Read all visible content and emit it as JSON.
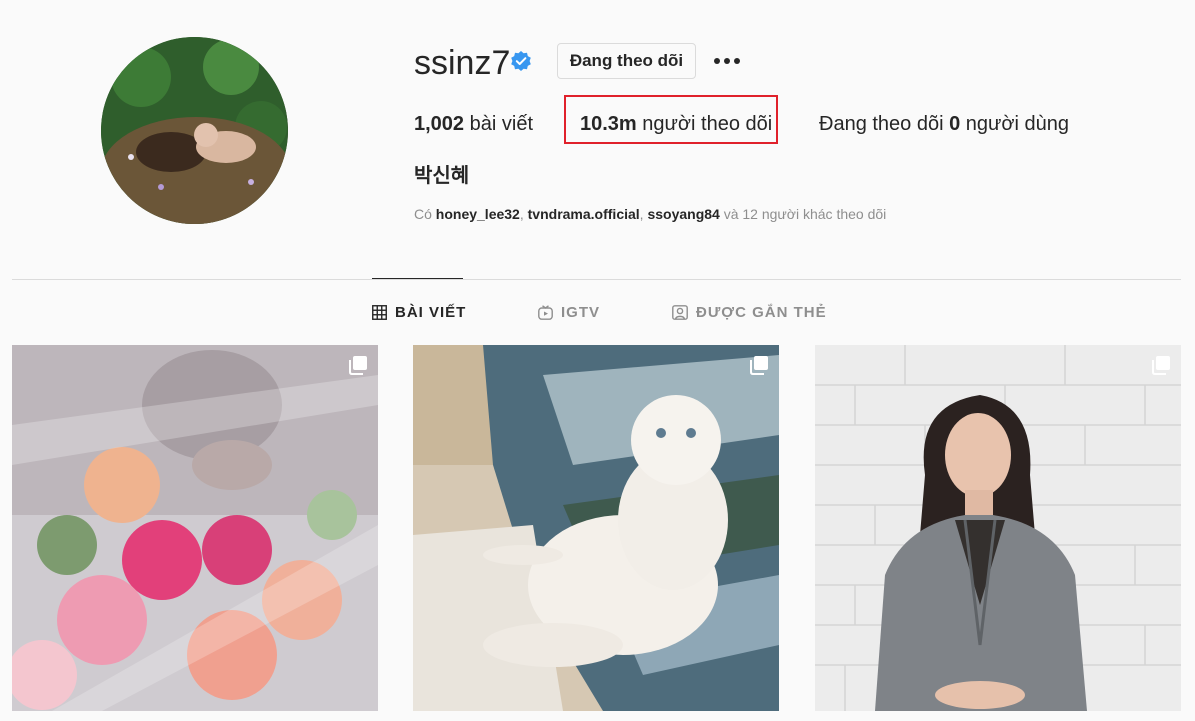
{
  "profile": {
    "username": "ssinz7",
    "follow_button": "Đang theo dõi",
    "full_name": "박신혜"
  },
  "stats": {
    "posts_count": "1,002",
    "posts_label": "bài viết",
    "followers_count": "10.3m",
    "followers_label": "người theo dõi",
    "following_prefix": "Đang theo dõi",
    "following_count": "0",
    "following_label": "người dùng"
  },
  "followed_by": {
    "prefix": "Có",
    "accounts": [
      "honey_lee32",
      "tvndrama.official",
      "ssoyang84"
    ],
    "suffix": "và 12 người khác theo dõi"
  },
  "tabs": [
    {
      "label": "BÀI VIẾT",
      "icon": "grid-icon",
      "active": true
    },
    {
      "label": "IGTV",
      "icon": "igtv-icon",
      "active": false
    },
    {
      "label": "ĐƯỢC GẮN THẺ",
      "icon": "tagged-icon",
      "active": false
    }
  ],
  "posts": [
    {
      "subject": "flowers-behind-plastic",
      "type": "carousel"
    },
    {
      "subject": "white-cat-on-chair",
      "type": "carousel"
    },
    {
      "subject": "woman-grey-blazer",
      "type": "carousel"
    }
  ],
  "colors": {
    "verified": "#3897f0",
    "highlight_border": "#e0212b",
    "muted_text": "#8e8e8e",
    "primary_text": "#262626"
  }
}
